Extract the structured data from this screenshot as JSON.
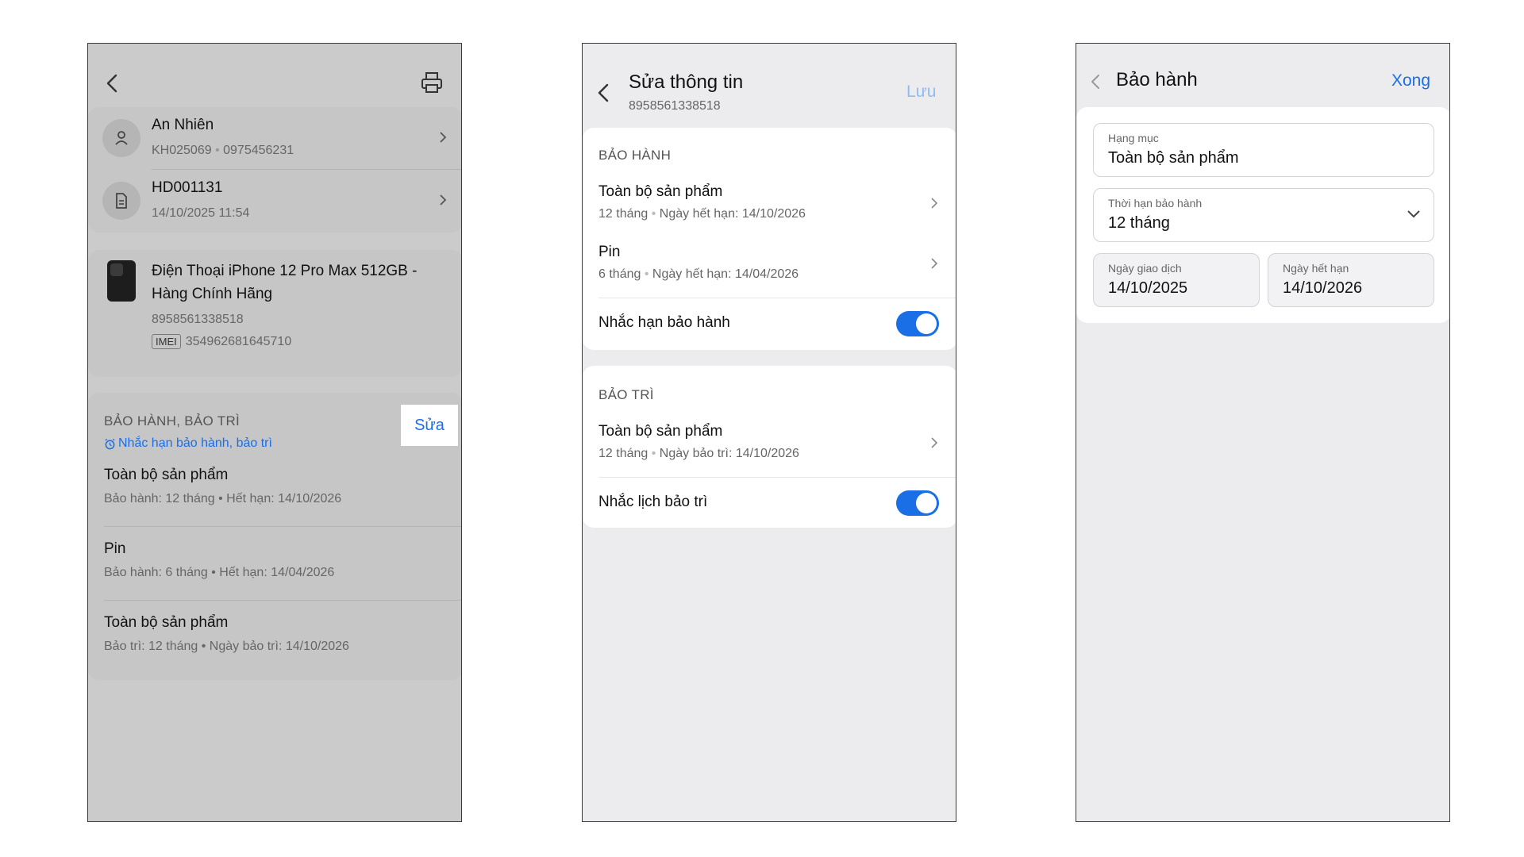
{
  "screen1": {
    "customer": {
      "name": "An Nhiên",
      "code": "KH025069",
      "phone": "0975456231"
    },
    "invoice": {
      "code": "HD001131",
      "datetime": "14/10/2025 11:54"
    },
    "product": {
      "name_line1": "Điện Thoại iPhone 12 Pro Max 512GB -",
      "name_line2": "Hàng Chính Hãng",
      "barcode": "8958561338518",
      "imei_label": "IMEI",
      "imei": "354962681645710"
    },
    "section": {
      "title": "BẢO HÀNH, BẢO TRÌ",
      "reminder": "Nhắc hạn bảo hành, bảo trì",
      "edit_label": "Sửa"
    },
    "items": [
      {
        "title": "Toàn bộ sản phẩm",
        "detail": "Bảo hành: 12 tháng • Hết hạn: 14/10/2026"
      },
      {
        "title": "Pin",
        "detail": "Bảo hành: 6 tháng • Hết hạn: 14/04/2026"
      },
      {
        "title": "Toàn bộ sản phẩm",
        "detail": "Bảo trì: 12 tháng • Ngày bảo trì: 14/10/2026"
      }
    ]
  },
  "screen2": {
    "title": "Sửa thông tin",
    "subtitle": "8958561338518",
    "save_label": "Lưu",
    "warranty": {
      "header": "BẢO HÀNH",
      "items": [
        {
          "title": "Toàn bộ sản phẩm",
          "duration": "12 tháng",
          "expiry": "Ngày hết hạn: 14/10/2026"
        },
        {
          "title": "Pin",
          "duration": "6 tháng",
          "expiry": "Ngày hết hạn: 14/04/2026"
        }
      ],
      "toggle_label": "Nhắc hạn bảo hành",
      "toggle_on": true
    },
    "maintenance": {
      "header": "BẢO TRÌ",
      "items": [
        {
          "title": "Toàn bộ sản phẩm",
          "duration": "12 tháng",
          "date": "Ngày bảo trì: 14/10/2026"
        }
      ],
      "toggle_label": "Nhắc lịch bảo trì",
      "toggle_on": true
    }
  },
  "screen3": {
    "title": "Bảo hành",
    "done_label": "Xong",
    "category": {
      "label": "Hạng mục",
      "value": "Toàn bộ sản phẩm"
    },
    "duration": {
      "label": "Thời hạn bảo hành",
      "value": "12 tháng"
    },
    "transaction_date": {
      "label": "Ngày giao dịch",
      "value": "14/10/2025"
    },
    "expiry_date": {
      "label": "Ngày hết hạn",
      "value": "14/10/2026"
    }
  },
  "colors": {
    "accent": "#1a6fe6",
    "toggle_on": "#1a6fe6"
  }
}
